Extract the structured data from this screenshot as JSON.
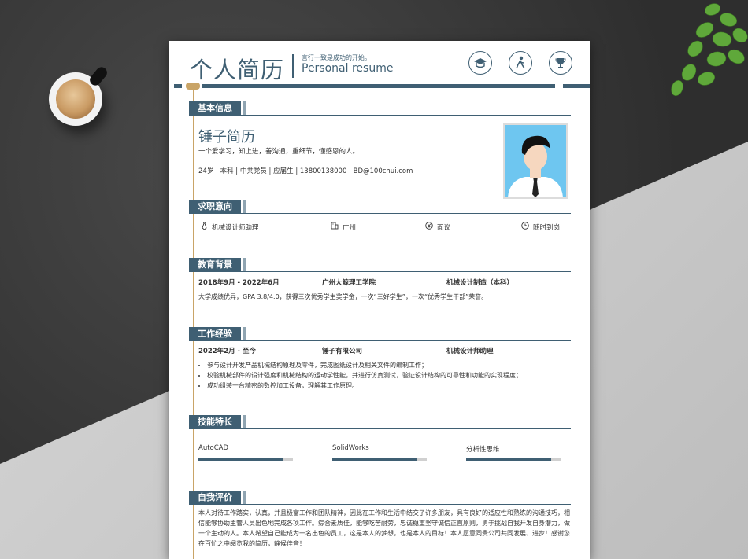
{
  "header": {
    "title": "个人简历",
    "subtitle_cn": "言行一致是成功的开始。",
    "subtitle_en": "Personal resume",
    "icons": [
      "graduation-cap-icon",
      "person-icon",
      "trophy-icon"
    ]
  },
  "sections": {
    "basic": "基本信息",
    "intent": "求职意向",
    "education": "教育背景",
    "work": "工作经验",
    "skills": "技能特长",
    "evaluation": "自我评价"
  },
  "basic": {
    "name": "锤子简历",
    "motto": "一个爱学习，知上进，善沟通，重细节，懂感恩的人。",
    "meta": "24岁 | 本科 | 中共党员 | 应届生 | 13800138000 | BD@100chui.com"
  },
  "intent": {
    "position": "机械设计师助理",
    "city": "广州",
    "salary": "面议",
    "availability": "随时到岗"
  },
  "education": {
    "period": "2018年9月 - 2022年6月",
    "school": "广州大鲸理工学院",
    "major": "机械设计制造（本科）",
    "detail": "大学成绩优异，GPA 3.8/4.0，获得三次优秀学生奖学金，一次“三好学生”，一次“优秀学生干部”荣誉。"
  },
  "work": {
    "period": "2022年2月 - 至今",
    "company": "锤子有限公司",
    "role": "机械设计师助理",
    "duties": [
      "参与设计开发产品机械结构原理及零件，完成图纸设计及相关文件的编制工作；",
      "校验机械部件的设计强度和机械结构的运动学性能，并进行仿真测试，验证设计结构的可靠性和功能的实现程度；",
      "成功组装一台精密的数控加工设备，理解其工作原理。"
    ]
  },
  "skills": [
    {
      "name": "AutoCAD",
      "level": 0.9
    },
    {
      "name": "SolidWorks",
      "level": 0.9
    },
    {
      "name": "分析性思维",
      "level": 0.9
    }
  ],
  "evaluation": "本人对待工作踏实，认真，并且极富工作和团队精神，因此在工作和生活中结交了许多朋友，具有良好的适应性和熟练的沟通技巧，相信能够协助主管人员出色地完成各项工作。综合素质佳，能够吃苦耐劳，忠诚稳重坚守诚信正直原则，勇于挑战自我开发自身潜力，做一个主动的人。本人希望自己能成为一名出色的员工，这是本人的梦想，也是本人的目标！本人愿意同贵公司共同发展、进步！感谢您在百忙之中阅览我的简历，静候佳音！",
  "colors": {
    "accent": "#3f5f73",
    "gold": "#c9a467",
    "photo_bg": "#6ec6f0"
  }
}
